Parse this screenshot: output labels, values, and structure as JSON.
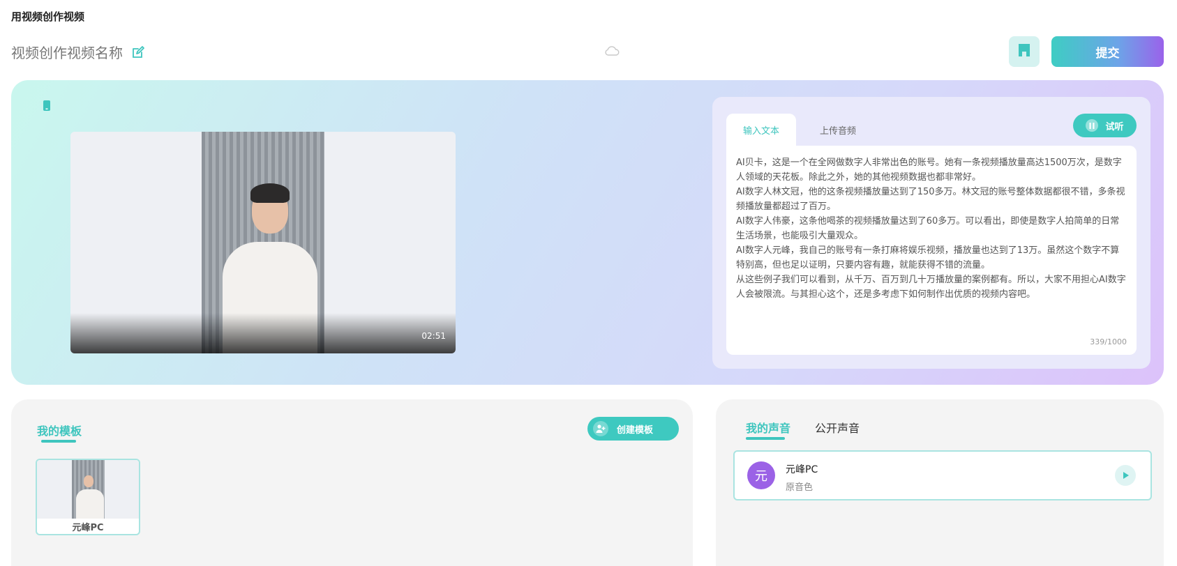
{
  "page": {
    "heading": "用视频创作视频",
    "project_name": "视频创作视频名称"
  },
  "toolbar": {
    "submit_label": "提交"
  },
  "preview": {
    "duration": "02:51"
  },
  "script": {
    "tabs": [
      "输入文本",
      "上传音频"
    ],
    "listen_label": "试听",
    "text": "AI贝卡，这是一个在全网做数字人非常出色的账号。她有一条视频播放量高达1500万次，是数字人领域的天花板。除此之外，她的其他视频数据也都非常好。\nAI数字人林文冠，他的这条视频播放量达到了150多万。林文冠的账号整体数据都很不错，多条视频播放量都超过了百万。\nAI数字人伟豪，这条他喝茶的视频播放量达到了60多万。可以看出，即使是数字人拍简单的日常生活场景，也能吸引大量观众。\nAI数字人元峰，我自己的账号有一条打麻将娱乐视频，播放量也达到了13万。虽然这个数字不算特别高，但也足以证明，只要内容有趣，就能获得不错的流量。\n从这些例子我们可以看到，从千万、百万到几十万播放量的案例都有。所以，大家不用担心AI数字人会被限流。与其担心这个，还是多考虑下如何制作出优质的视频内容吧。",
    "char_count": "339/1000"
  },
  "templates": {
    "tab_label": "我的模板",
    "create_label": "创建模板",
    "items": [
      {
        "name": "元峰PC"
      }
    ]
  },
  "voices": {
    "tabs": [
      "我的声音",
      "公开声音"
    ],
    "items": [
      {
        "avatar_char": "元",
        "name": "元峰PC",
        "subtitle": "原音色"
      }
    ]
  },
  "colors": {
    "accent": "#3ec9c0",
    "avatar": "#9b62e6"
  }
}
